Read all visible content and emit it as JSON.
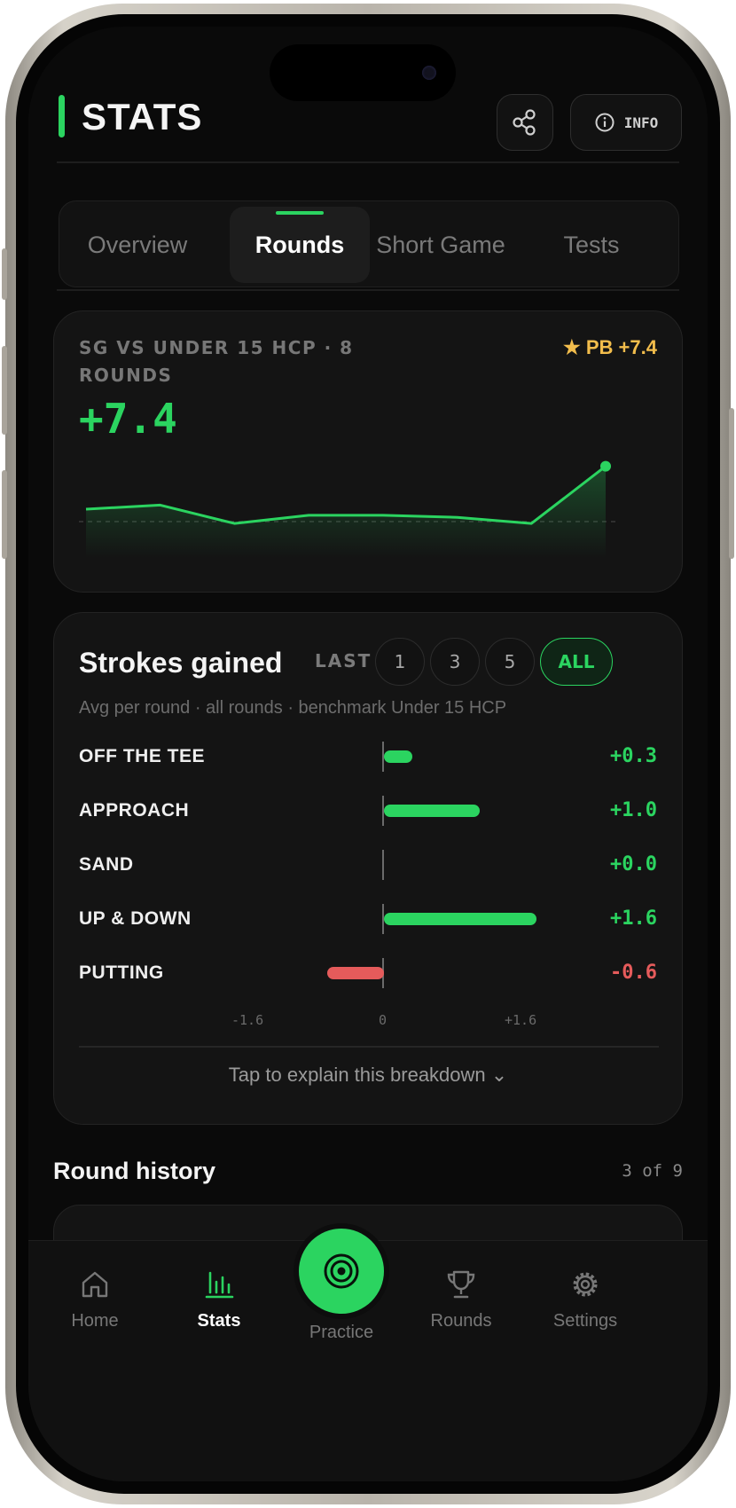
{
  "header": {
    "title": "STATS",
    "info_label": "INFO"
  },
  "tabs": [
    {
      "label": "Overview"
    },
    {
      "label": "Rounds"
    },
    {
      "label": "Short Game"
    },
    {
      "label": "Tests"
    }
  ],
  "summary": {
    "label": "SG VS UNDER 15 HCP · 8 ROUNDS",
    "pb": "★ PB +7.4",
    "value": "+7.4"
  },
  "strokes_gained": {
    "title": "Strokes gained",
    "last_label": "LAST",
    "filters": [
      "1",
      "3",
      "5",
      "ALL"
    ],
    "active_filter": "ALL",
    "subtitle": "Avg per round · all rounds · benchmark Under 15 HCP",
    "explain_label": "Tap to explain this breakdown ⌄"
  },
  "chart_data": [
    {
      "type": "line",
      "x": [
        1,
        2,
        3,
        4,
        5,
        6,
        7,
        8
      ],
      "series": [
        {
          "values": [
            5.3,
            5.5,
            4.6,
            5.0,
            5.0,
            4.9,
            4.6,
            7.4
          ]
        }
      ],
      "baseline": 4.6
    },
    {
      "type": "bar",
      "orientation": "horizontal",
      "categories": [
        "OFF THE TEE",
        "APPROACH",
        "SAND",
        "UP & DOWN",
        "PUTTING"
      ],
      "values": [
        0.3,
        1.0,
        0.0,
        1.6,
        -0.6
      ],
      "value_labels": [
        "+0.3",
        "+1.0",
        "+0.0",
        "+1.6",
        "-0.6"
      ],
      "tick_labels": [
        "-1.6",
        "0",
        "+1.6"
      ],
      "xlim": [
        -1.6,
        1.6
      ]
    }
  ],
  "round_history": {
    "title": "Round history",
    "count": "3 of 9"
  },
  "nav": {
    "items": [
      {
        "label": "Home"
      },
      {
        "label": "Stats"
      },
      {
        "label": "Practice"
      },
      {
        "label": "Rounds"
      },
      {
        "label": "Settings"
      }
    ]
  },
  "colors": {
    "accent": "#2bd460",
    "negative": "#e55b5b",
    "gold": "#f2bd4c",
    "background": "#0a0a0a"
  }
}
